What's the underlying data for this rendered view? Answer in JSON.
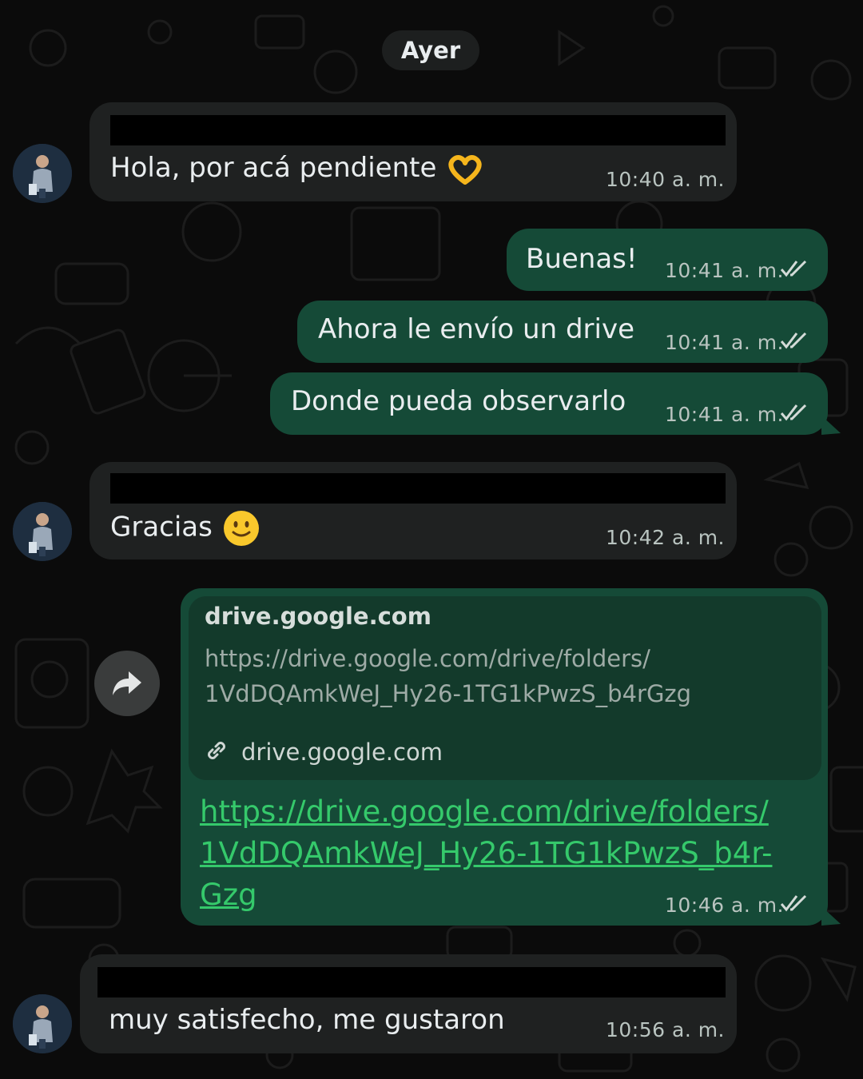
{
  "date_separator": "Ayer",
  "messages": [
    {
      "direction": "in",
      "text": "Hola, por acá pendiente",
      "emoji": "heart-hands",
      "time": "10:40 a. m."
    },
    {
      "direction": "out",
      "text": "Buenas!",
      "time": "10:41 a. m.",
      "status": "read"
    },
    {
      "direction": "out",
      "text": "Ahora le envío un drive",
      "time": "10:41 a. m.",
      "status": "read"
    },
    {
      "direction": "out",
      "text": "Donde pueda observarlo",
      "time": "10:41 a. m.",
      "status": "read"
    },
    {
      "direction": "in",
      "text": "Gracias",
      "emoji": "slightly-smiling-face",
      "time": "10:42 a. m."
    },
    {
      "direction": "out",
      "type": "link",
      "preview": {
        "domain_title": "drive.google.com",
        "url_line1": "https://drive.google.com/drive/folders/",
        "url_line2": "1VdDQAmkWeJ_Hy26-1TG1kPwzS_b4rGzg",
        "site": "drive.google.com"
      },
      "link_line1": "https://drive.google.com/drive/folders/",
      "link_line2": "1VdDQAmkWeJ_Hy26-1TG1kPwzS_b4r-",
      "link_line3": "Gzg",
      "time": "10:46 a. m.",
      "status": "read"
    },
    {
      "direction": "in",
      "text": "muy satisfecho, me gustaron",
      "time": "10:56 a. m."
    }
  ],
  "icons": {
    "forward": "forward-arrow-icon",
    "link": "chain-link-icon",
    "read_receipt": "double-check-icon"
  },
  "colors": {
    "background": "#0b0b0b",
    "incoming_bubble": "#1f2121",
    "outgoing_bubble": "#154a37",
    "link": "#35c96b"
  }
}
